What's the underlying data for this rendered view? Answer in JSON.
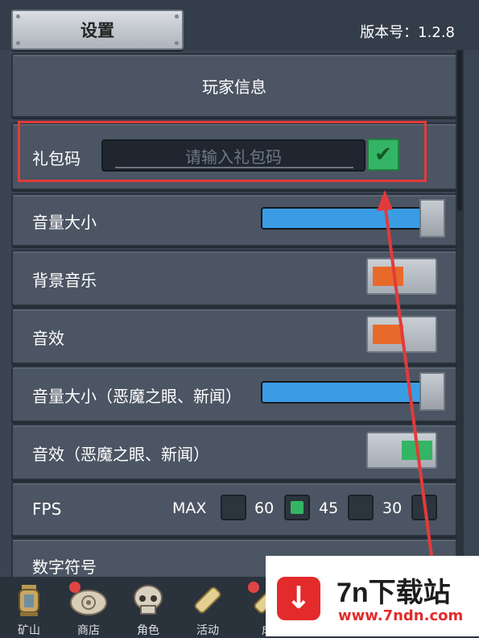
{
  "header": {
    "title": "设置",
    "version": "版本号：1.2.8"
  },
  "player_info": {
    "label": "玩家信息"
  },
  "gift_code": {
    "label": "礼包码",
    "placeholder": "请输入礼包码",
    "confirm_icon": "check-icon"
  },
  "volume": {
    "label": "音量大小",
    "value": 1.0
  },
  "bgm": {
    "label": "背景音乐",
    "state": "off"
  },
  "sfx": {
    "label": "音效",
    "state": "off"
  },
  "volume_eye": {
    "label": "音量大小（恶魔之眼、新闻）",
    "value": 1.0
  },
  "sfx_eye": {
    "label": "音效（恶魔之眼、新闻）",
    "state": "on"
  },
  "fps": {
    "label": "FPS",
    "options": [
      {
        "label": "MAX",
        "selected": false
      },
      {
        "label": "60",
        "selected": true
      },
      {
        "label": "45",
        "selected": false
      },
      {
        "label": "30",
        "selected": false
      }
    ]
  },
  "digit_symbol": {
    "label": "数字符号"
  },
  "nav": [
    {
      "label": "矿山",
      "icon": "lantern-icon",
      "badge": false
    },
    {
      "label": "商店",
      "icon": "fossil-shell-icon",
      "badge": true
    },
    {
      "label": "角色",
      "icon": "skull-icon",
      "badge": false
    },
    {
      "label": "活动",
      "icon": "scroll-icon",
      "badge": false
    },
    {
      "label": "成",
      "icon": "scroll-icon",
      "badge": true
    }
  ],
  "colors": {
    "accent_green": "#34b565",
    "toggle_off": "#e86a2a",
    "slider_blue": "#3a9de4",
    "highlight_red": "#e23b3b"
  },
  "watermark": {
    "title": "7n下载站",
    "url": "www.7ndn.com"
  }
}
